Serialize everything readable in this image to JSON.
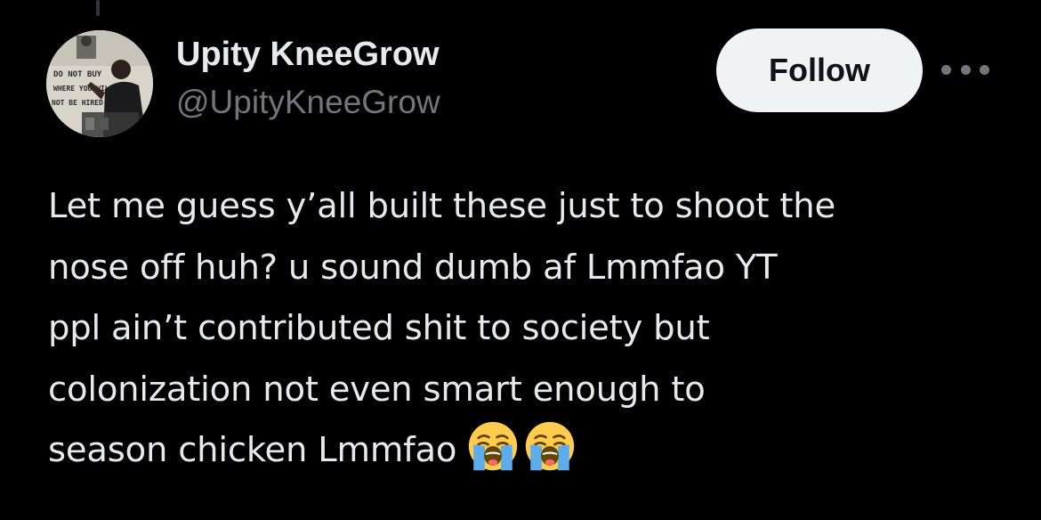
{
  "author": {
    "display_name": "Upity KneeGrow",
    "handle": "@UpityKneeGrow",
    "avatar_sign_lines": [
      "DO NOT BUY",
      "WHERE YOU WILL",
      "NOT BE HIRED"
    ]
  },
  "actions": {
    "follow_label": "Follow",
    "more_icon": "more-horizontal-icon"
  },
  "tweet": {
    "lines": [
      "Let me guess y’all built these just to shoot the",
      "nose off huh? u sound dumb af Lmmfao YT",
      "ppl ain’t contributed shit to society but",
      "colonization not even smart enough to",
      "season chicken Lmmfao"
    ],
    "emojis": [
      "loudly-crying-face-emoji",
      "loudly-crying-face-emoji"
    ]
  },
  "colors": {
    "background": "#000000",
    "text_primary": "#e7e9ea",
    "text_secondary": "#71767b",
    "follow_bg": "#eff3f4",
    "follow_text": "#0f1419"
  }
}
